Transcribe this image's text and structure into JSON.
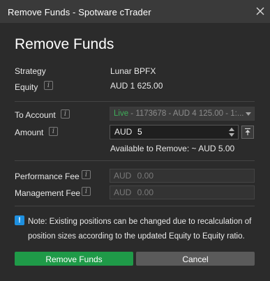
{
  "window": {
    "title": "Remove Funds - Spotware cTrader"
  },
  "heading": "Remove Funds",
  "strategy": {
    "label": "Strategy",
    "value": "Lunar BPFX"
  },
  "equity": {
    "label": "Equity",
    "value": "AUD 1 625.00"
  },
  "to_account": {
    "label": "To Account",
    "status": "Live",
    "selected": " - 1173678 - AUD 4 125.00 - 1:..."
  },
  "amount": {
    "label": "Amount",
    "currency": "AUD",
    "value": "5",
    "available": "Available to Remove:  ~ AUD 5.00"
  },
  "performance_fee": {
    "label": "Performance Fee",
    "value": "AUD   0.00"
  },
  "management_fee": {
    "label": "Management Fee",
    "value": "AUD   0.00"
  },
  "note": {
    "icon": "!",
    "text": "Note: Existing positions can be changed due to recalculation of position sizes according to the updated Equity to Equity ratio."
  },
  "buttons": {
    "confirm": "Remove Funds",
    "cancel": "Cancel"
  },
  "info_glyph": "i",
  "colors": {
    "primary": "#1f9a48",
    "live": "#3fae5a",
    "note_icon": "#1e90e0"
  }
}
